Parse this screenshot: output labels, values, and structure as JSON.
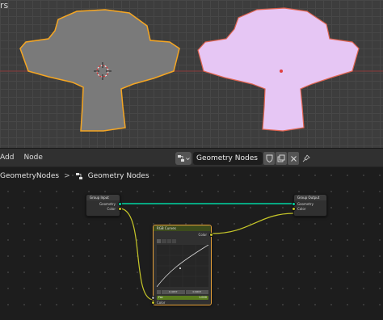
{
  "viewport": {
    "title_fragment": "rs"
  },
  "header": {
    "menus": [
      "Add",
      "Node"
    ],
    "tree_name": "Geometry Nodes"
  },
  "breadcrumb": {
    "object": "GeometryNodes",
    "separator": ">",
    "tree": "Geometry Nodes"
  },
  "nodes": {
    "group_input": {
      "title": "Group Input",
      "outputs": [
        "Geometry",
        "Color"
      ]
    },
    "group_output": {
      "title": "Group Output",
      "inputs": [
        "Geometry",
        "Color"
      ]
    },
    "rgb_curves": {
      "title": "RGB Curves",
      "output": "Color",
      "fac_label": "Fac",
      "fac_value": "1.000",
      "min_value": "0.4037",
      "max_value": "0.9603",
      "input": "Color"
    }
  },
  "colors": {
    "selection_orange": "#f5a623",
    "color_attribute_lilac": "#e6c6f4",
    "geometry_socket": "#00d6a3",
    "color_socket": "#c7c729",
    "input_node_header": "#3b3b3b",
    "curves_node_header": "#3c4b1c"
  }
}
